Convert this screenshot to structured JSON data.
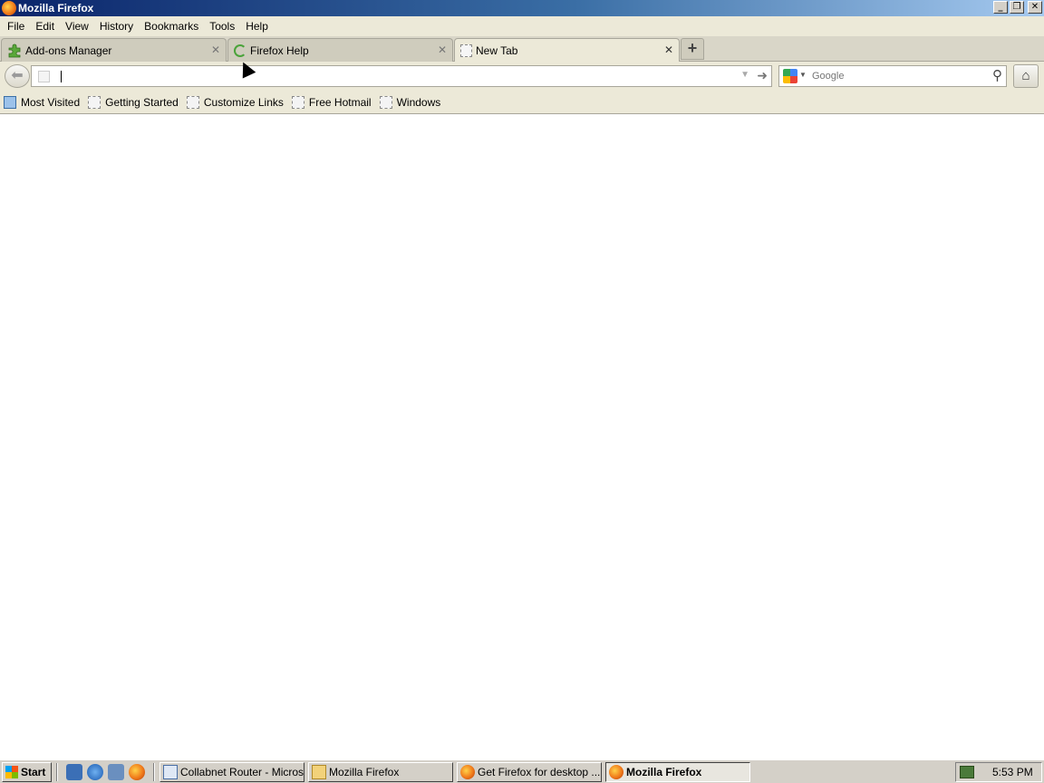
{
  "window": {
    "title": "Mozilla Firefox"
  },
  "menu": [
    "File",
    "Edit",
    "View",
    "History",
    "Bookmarks",
    "Tools",
    "Help"
  ],
  "tabs": [
    {
      "label": "Add-ons Manager",
      "icon": "puzzle-icon"
    },
    {
      "label": "Firefox Help",
      "icon": "loading-spinner-icon"
    },
    {
      "label": "New Tab",
      "icon": "blank-page-icon"
    }
  ],
  "navbar": {
    "url_value": "",
    "search_engine": "Google",
    "search_placeholder": "Google"
  },
  "bookmarks": [
    "Most Visited",
    "Getting Started",
    "Customize Links",
    "Free Hotmail",
    "Windows"
  ],
  "taskbar": {
    "start_label": "Start",
    "tasks": [
      {
        "label": "Collabnet Router - Micros...",
        "icon": "ie-document-icon"
      },
      {
        "label": "Mozilla Firefox",
        "icon": "folder-icon"
      },
      {
        "label": "Get Firefox for desktop ...",
        "icon": "firefox-icon"
      },
      {
        "label": "Mozilla Firefox",
        "icon": "firefox-icon"
      }
    ],
    "clock": "5:53 PM"
  },
  "colors": {
    "titlebar_start": "#0a246a",
    "titlebar_end": "#a6caf0",
    "chrome": "#ece9d8",
    "taskbar": "#d4d0c8"
  }
}
